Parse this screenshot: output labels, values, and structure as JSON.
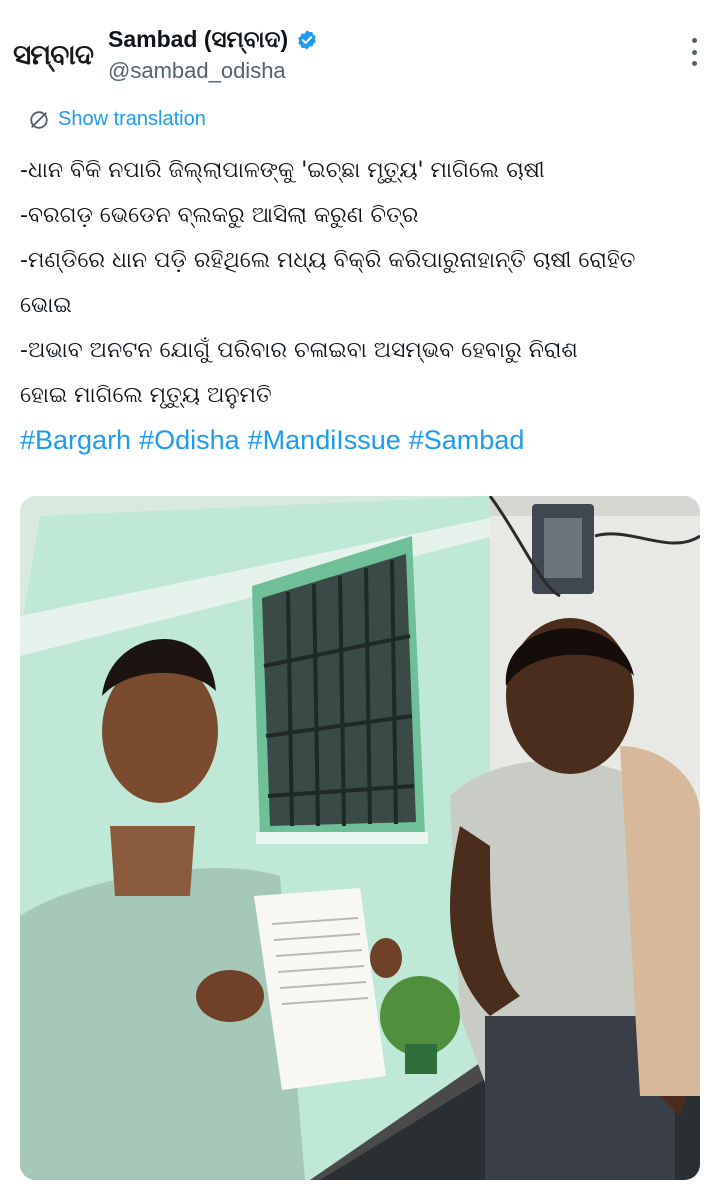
{
  "header": {
    "avatar_text": "ସମ୍ବାଦ",
    "display_name": "Sambad (ସମ୍ବାଦ)",
    "handle": "@sambad_odisha"
  },
  "translation": {
    "label": "Show translation"
  },
  "tweet": {
    "lines": [
      "-ଧାନ ବିକି ନପାରି ଜିଲ୍ଲାପାଳଙ୍କୁ 'ଇଚ୍ଛା ମୃତ୍ୟୁ' ମାଗିଲେ ଚାଷୀ",
      "-ବରଗଡ଼ ଭେଡେନ ବ୍ଲକରୁ ଆସିଲା କରୁଣ ଚିତ୍ର",
      "-ମଣ୍ଡିରେ ଧାନ ପଡ଼ି ରହିଥିଲେ ମଧ୍ୟ ବିକ୍ରି କରିପାରୁନାହାନ୍ତି ଚାଷୀ ରୋହିତ",
      "ଭୋଇ",
      "-ଅଭାବ ଅନଟନ ଯୋଗୁଁ ପରିବାର ଚଳାଇବା ଅସମ୍ଭବ ହେବାରୁ ନିରାଶ",
      "ହୋଇ ମାଗିଲେ ମୃତ୍ୟୁ ଅନୁମତି"
    ],
    "hashtags": [
      "#Bargarh",
      "#Odisha",
      "#MandiIssue",
      "#Sambad"
    ]
  },
  "colors": {
    "link": "#1d9bf0",
    "verified": "#1d9bf0",
    "secondary_text": "#536471"
  },
  "icons": {
    "verified": "verified-badge-icon",
    "translate": "translate-icon",
    "more": "more-options-icon"
  }
}
